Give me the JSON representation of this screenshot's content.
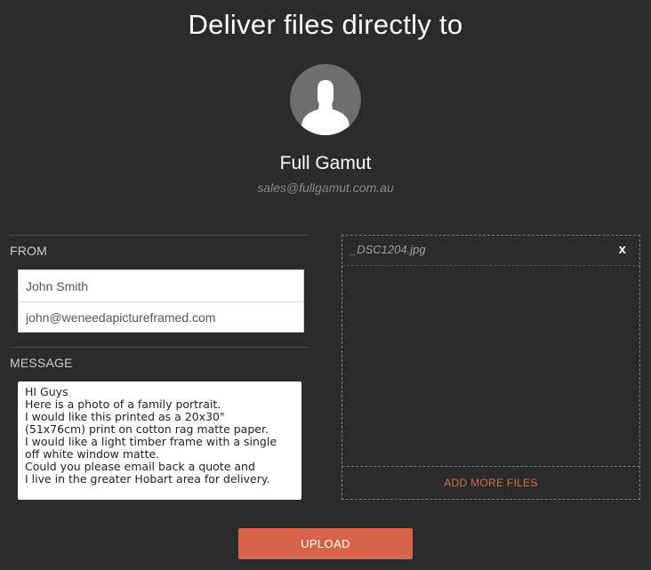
{
  "header": {
    "title": "Deliver files directly to"
  },
  "recipient": {
    "avatar_icon": "user-silhouette-icon",
    "name": "Full Gamut",
    "email": "sales@fullgamut.com.au"
  },
  "from": {
    "label": "FROM",
    "name_value": "John Smith",
    "email_value": "john@weneedapictureframed.com"
  },
  "message": {
    "label": "MESSAGE",
    "lines": [
      "HI Guys",
      "Here is a photo of a family portrait.",
      "I would like this printed as a 20x30\"",
      "(51x76cm) print on cotton rag matte paper.",
      "I would like a light timber frame with a single",
      "off white window matte.",
      "Could you please email back a quote and",
      "I live in the greater Hobart area for delivery."
    ]
  },
  "files": {
    "items": [
      {
        "name": "_DSC1204.jpg",
        "remove_label": "x"
      }
    ],
    "add_more_label": "ADD MORE FILES"
  },
  "actions": {
    "upload_label": "UPLOAD"
  },
  "colors": {
    "background": "#2b2b2b",
    "accent": "#d5644a",
    "avatar": "#6e6e6e"
  }
}
